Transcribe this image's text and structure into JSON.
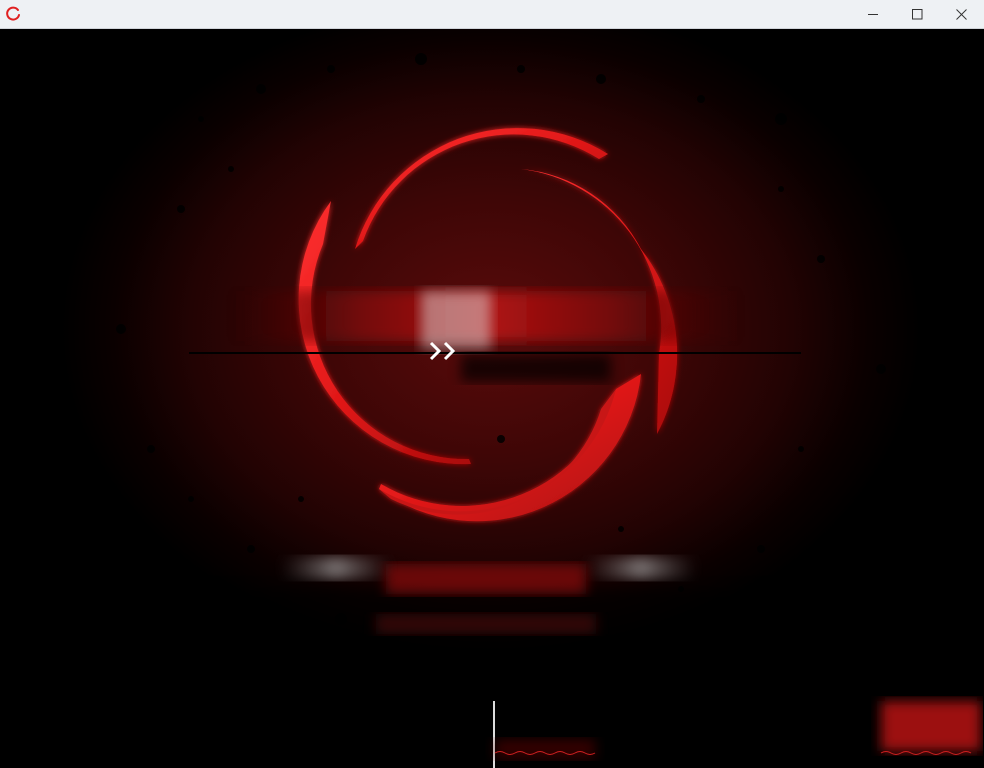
{
  "window": {
    "title": "",
    "app_icon": "red-ring-icon",
    "controls": {
      "minimize_icon": "minimize-icon",
      "maximize_icon": "maximize-icon",
      "close_icon": "close-icon"
    }
  },
  "splash": {
    "logo_icon": "red-swirl-logo-icon",
    "accent_color": "#e01a1a",
    "background_color": "#3e0606",
    "title_text": "",
    "subtitle_text": "",
    "status_text": ""
  }
}
